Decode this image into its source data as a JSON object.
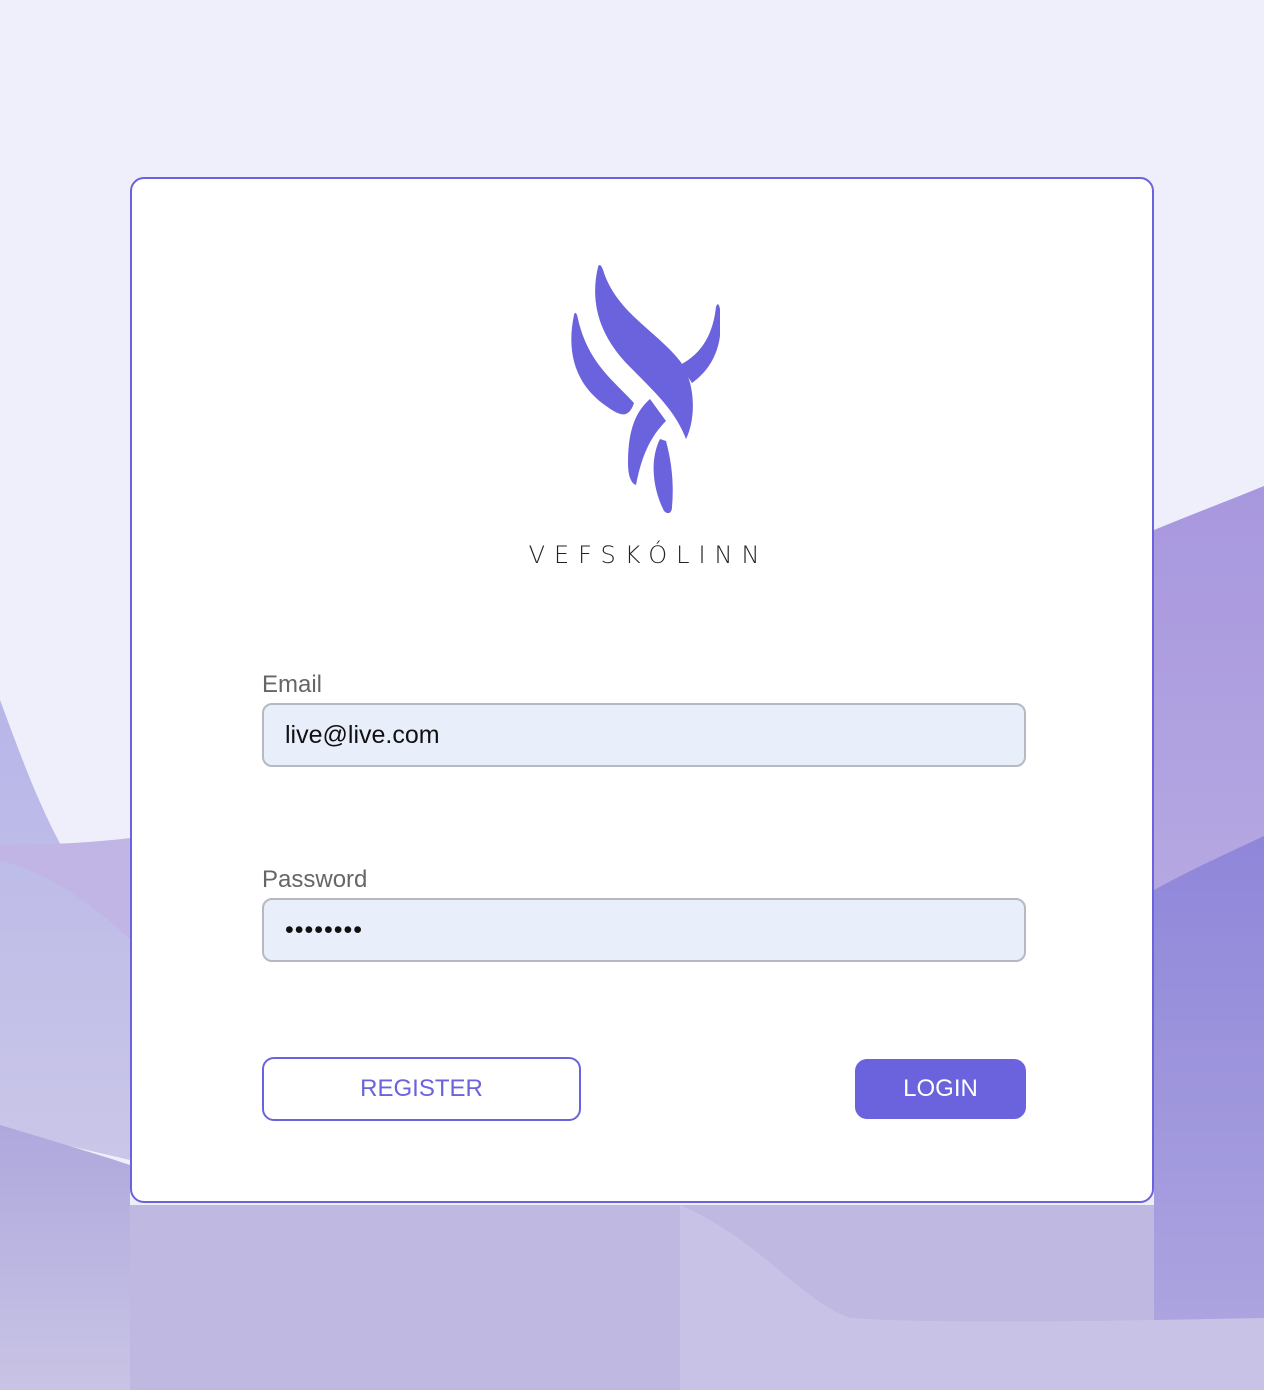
{
  "brand": {
    "name": "VEFSKÓLINN",
    "logo_icon": "vefskolinn-flame-logo",
    "color": "#6b63dd"
  },
  "form": {
    "email_label": "Email",
    "email_value": "live@live.com",
    "password_label": "Password",
    "password_value": "password"
  },
  "buttons": {
    "register_label": "REGISTER",
    "login_label": "LOGIN"
  },
  "colors": {
    "accent": "#6b63dd",
    "background": "#eeeffb",
    "input_background": "#e8effb",
    "wave_light": "#c7c3e5",
    "wave_dark": "#9a8fdc"
  }
}
